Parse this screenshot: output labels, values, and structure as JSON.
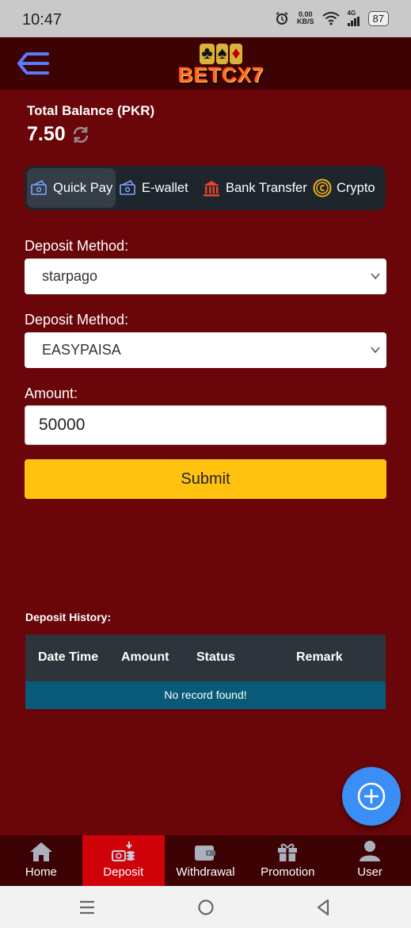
{
  "status_bar": {
    "time": "10:47",
    "speed_value": "0.00",
    "speed_unit": "KB/S",
    "network": "4G",
    "battery": "87"
  },
  "app": {
    "logo_text": "BETCX7"
  },
  "balance": {
    "label": "Total Balance (PKR)",
    "value": "7.50"
  },
  "tabs": [
    {
      "label": "Quick Pay",
      "icon": "card-icon",
      "active": true
    },
    {
      "label": "E-wallet",
      "icon": "card-icon"
    },
    {
      "label": "Bank Transfer",
      "icon": "bank-icon"
    },
    {
      "label": "Crypto",
      "icon": "coin-icon"
    }
  ],
  "form": {
    "method1_label": "Deposit Method:",
    "method1_value": "starpago",
    "method2_label": "Deposit Method:",
    "method2_value": "EASYPAISA",
    "amount_label": "Amount:",
    "amount_value": "50000",
    "submit_label": "Submit"
  },
  "history": {
    "title": "Deposit History:",
    "columns": [
      "Date Time",
      "Amount",
      "Status",
      "Remark"
    ],
    "empty_text": "No record found!"
  },
  "nav": [
    {
      "label": "Home",
      "icon": "home-icon"
    },
    {
      "label": "Deposit",
      "icon": "deposit-icon",
      "active": true
    },
    {
      "label": "Withdrawal",
      "icon": "wallet-icon"
    },
    {
      "label": "Promotion",
      "icon": "gift-icon"
    },
    {
      "label": "User",
      "icon": "user-icon"
    }
  ],
  "colors": {
    "background": "#6a0609",
    "header": "#3d0204",
    "accent": "#ffc20e",
    "active_nav": "#d0020a",
    "fab": "#3a8ef6"
  }
}
